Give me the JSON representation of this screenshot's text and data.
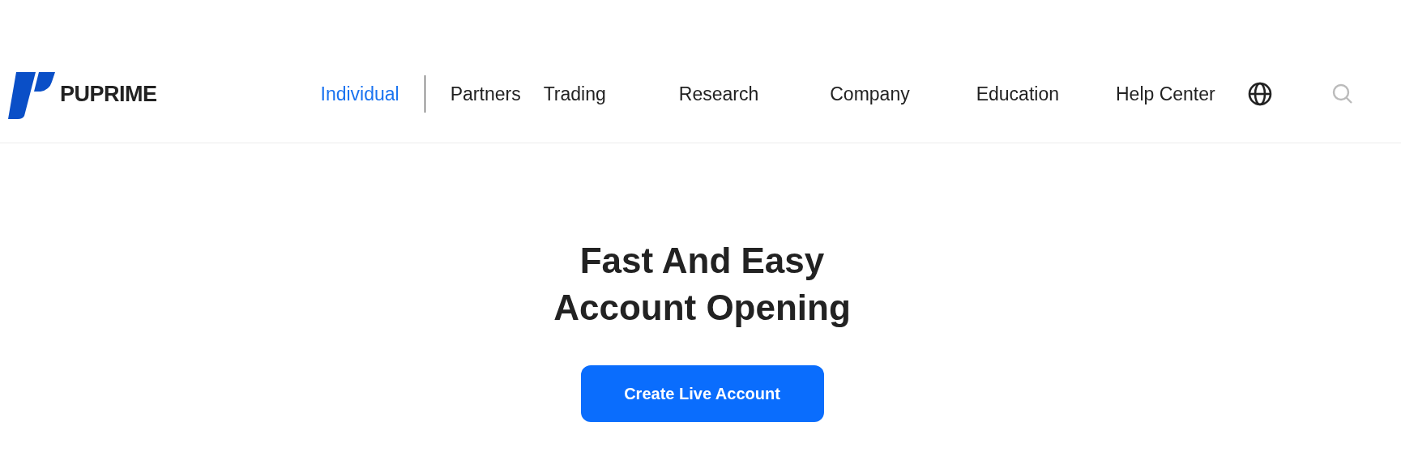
{
  "header": {
    "logo": "PUPRIME",
    "nav": [
      {
        "label": "Individual",
        "selected": true
      },
      {
        "label": "Partners",
        "selected": false
      },
      {
        "label": "Trading",
        "selected": false
      },
      {
        "label": "Research",
        "selected": false
      },
      {
        "label": "Company",
        "selected": false
      },
      {
        "label": "Education",
        "selected": false
      },
      {
        "label": "Help Center",
        "selected": false
      }
    ]
  },
  "hero": {
    "title_lines": [
      "Fast And Easy",
      "Account Opening"
    ],
    "button": "Create Live Account"
  }
}
